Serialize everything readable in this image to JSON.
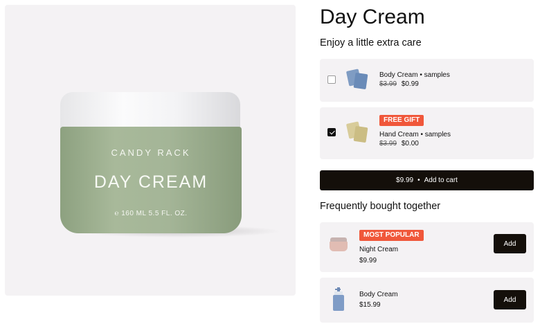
{
  "gallery": {
    "jar_brand": "CANDY RACK",
    "jar_name": "DAY CREAM",
    "jar_size": "℮ 160 ML 5.5 FL. OZ."
  },
  "product": {
    "title": "Day Cream"
  },
  "upsell": {
    "heading": "Enjoy a little extra care",
    "items": [
      {
        "name": "Body Cream • samples",
        "old_price": "$3.99",
        "price": "$0.99",
        "checked": false,
        "badge": ""
      },
      {
        "name": "Hand Cream • samples",
        "old_price": "$3.99",
        "price": "$0.00",
        "checked": true,
        "badge": "FREE GIFT"
      }
    ]
  },
  "cart": {
    "price": "$9.99",
    "separator": "•",
    "label": "Add to cart"
  },
  "fbt": {
    "heading": "Frequently bought together",
    "items": [
      {
        "badge": "MOST POPULAR",
        "name": "Night Cream",
        "price": "$9.99",
        "button": "Add"
      },
      {
        "badge": "",
        "name": "Body Cream",
        "price": "$15.99",
        "button": "Add"
      }
    ]
  },
  "colors": {
    "badge": "#f0573a",
    "button": "#140f0a",
    "card_bg": "#f4f2f4",
    "jar_green": "#a4b597"
  }
}
